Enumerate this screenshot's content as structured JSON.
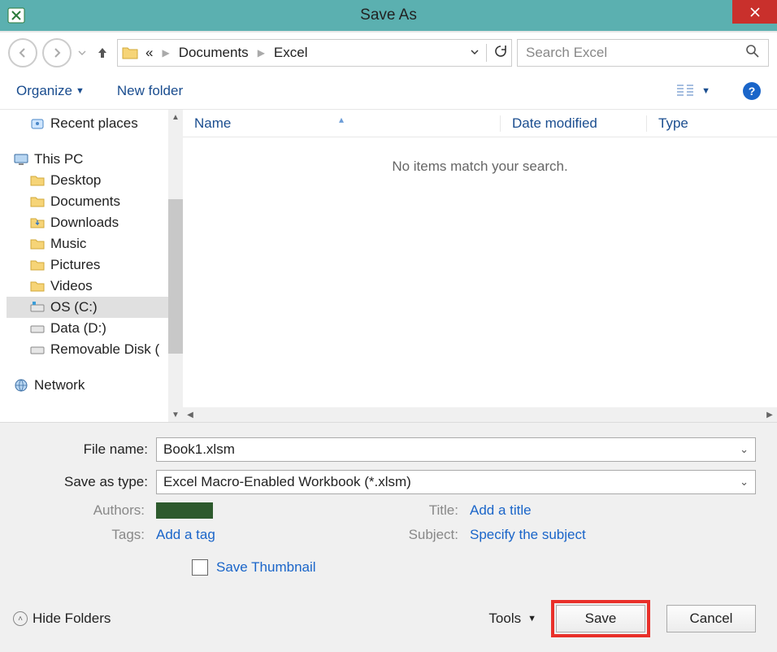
{
  "title": "Save As",
  "breadcrumb": {
    "ellipsis": "«",
    "items": [
      "Documents",
      "Excel"
    ]
  },
  "search": {
    "placeholder": "Search Excel"
  },
  "toolbar": {
    "organize": "Organize",
    "new_folder": "New folder"
  },
  "navtree": {
    "recent_places": "Recent places",
    "this_pc": "This PC",
    "desktop": "Desktop",
    "documents": "Documents",
    "downloads": "Downloads",
    "music": "Music",
    "pictures": "Pictures",
    "videos": "Videos",
    "os_c": "OS (C:)",
    "data_d": "Data (D:)",
    "removable": "Removable Disk (",
    "network": "Network"
  },
  "columns": {
    "name": "Name",
    "date_modified": "Date modified",
    "type": "Type"
  },
  "empty_msg": "No items match your search.",
  "form": {
    "file_name_label": "File name:",
    "file_name_value": "Book1.xlsm",
    "save_type_label": "Save as type:",
    "save_type_value": "Excel Macro-Enabled Workbook (*.xlsm)",
    "authors_label": "Authors:",
    "tags_label": "Tags:",
    "tags_value": "Add a tag",
    "title_label": "Title:",
    "title_value": "Add a title",
    "subject_label": "Subject:",
    "subject_value": "Specify the subject",
    "save_thumbnail": "Save Thumbnail"
  },
  "footer": {
    "hide_folders": "Hide Folders",
    "tools": "Tools",
    "save": "Save",
    "cancel": "Cancel"
  }
}
